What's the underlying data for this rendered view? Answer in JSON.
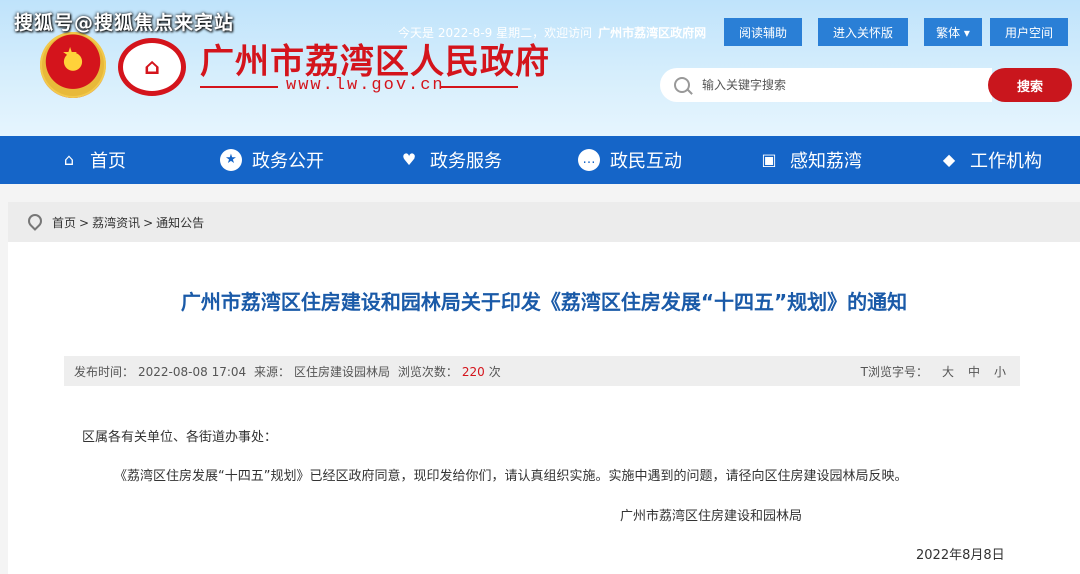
{
  "watermark": "搜狐号@搜狐焦点来宾站",
  "header": {
    "site_title": "广州市荔湾区人民政府",
    "site_url": "www.lw.gov.cn",
    "today_text": "今天是 2022-8-9 星期二，欢迎访问",
    "site_name_bold": "广州市荔湾区政府网",
    "buttons": {
      "reading_aid": "阅读辅助",
      "elderly_mode": "进入关怀版",
      "traditional": "繁体 ▾",
      "user_space": "用户空间"
    },
    "search": {
      "placeholder": "输入关键字搜索",
      "button_label": "搜索"
    }
  },
  "nav": {
    "items": [
      {
        "label": "首页",
        "icon": "home-icon"
      },
      {
        "label": "政务公开",
        "icon": "star-icon"
      },
      {
        "label": "政务服务",
        "icon": "heart-icon"
      },
      {
        "label": "政民互动",
        "icon": "chat-icon"
      },
      {
        "label": "感知荔湾",
        "icon": "image-icon"
      },
      {
        "label": "工作机构",
        "icon": "cube-icon"
      }
    ]
  },
  "breadcrumb": {
    "items": [
      "首页",
      "荔湾资讯",
      "通知公告"
    ],
    "separator": ">"
  },
  "article": {
    "title": "广州市荔湾区住房建设和园林局关于印发《荔湾区住房发展“十四五”规划》的通知",
    "meta": {
      "publish_label": "发布时间：",
      "publish_time": "2022-08-08 17:04",
      "source_label": "来源：",
      "source": "区住房建设园林局",
      "views_label": "浏览次数：",
      "views": "220",
      "views_unit": "次",
      "font_size_label": "T浏览字号：",
      "font_sizes": [
        "大",
        "中",
        "小"
      ]
    },
    "salutation": "区属各有关单位、各街道办事处：",
    "paragraph": "《荔湾区住房发展“十四五”规划》已经区政府同意，现印发给你们，请认真组织实施。实施中遇到的问题，请径向区住房建设园林局反映。",
    "signature": "广州市荔湾区住房建设和园林局",
    "date": "2022年8月8日"
  },
  "colors": {
    "brand_red": "#d4141c",
    "nav_blue": "#1565c8",
    "title_blue": "#1a5aa8",
    "button_blue": "#2a7fd6"
  }
}
